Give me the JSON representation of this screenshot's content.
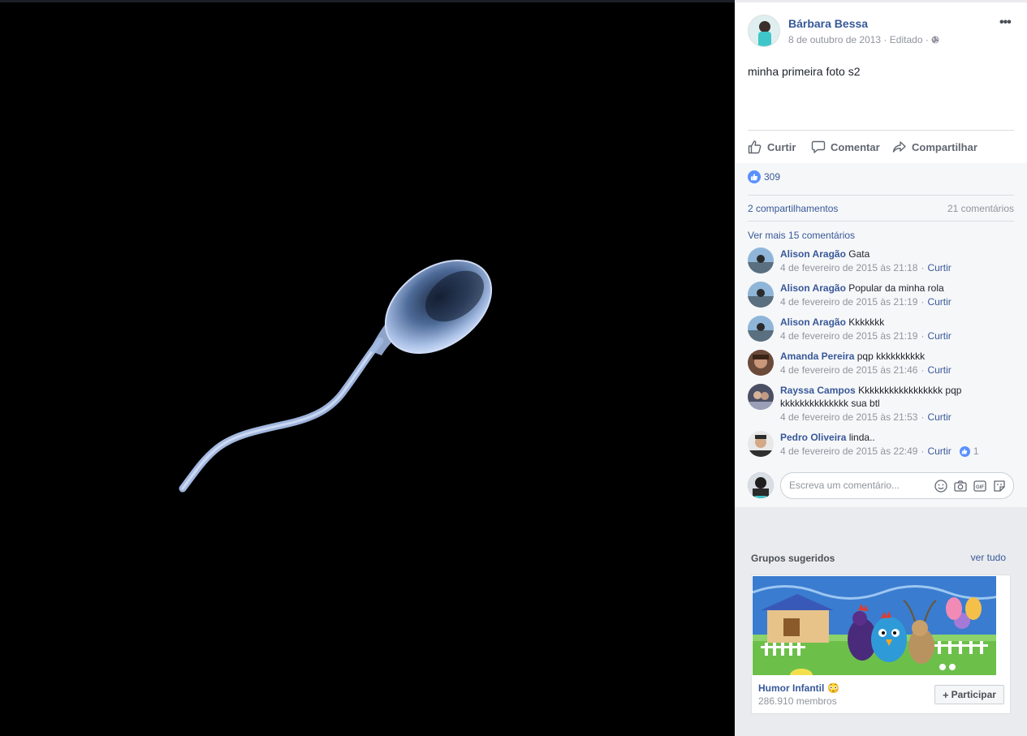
{
  "post": {
    "author": "Bárbara Bessa",
    "date": "8 de outubro de 2013",
    "edited": "Editado",
    "separator": "·",
    "more_icon": "more-options-icon",
    "privacy_icon": "globe-icon",
    "text": "minha primeira foto s2"
  },
  "actions": {
    "like": "Curtir",
    "comment": "Comentar",
    "share": "Compartilhar"
  },
  "stats": {
    "reactions": "309",
    "shares": "2 compartilhamentos",
    "comments": "21 comentários"
  },
  "comments_section": {
    "view_more": "Ver mais 15 comentários",
    "reply_label": "Curtir",
    "items": [
      {
        "name": "Alison Aragão",
        "text": "Gata",
        "time": "4 de fevereiro de 2015 às 21:18"
      },
      {
        "name": "Alison Aragão",
        "text": "Popular da minha rola",
        "time": "4 de fevereiro de 2015 às 21:19"
      },
      {
        "name": "Alison Aragão",
        "text": "Kkkkkkk",
        "time": "4 de fevereiro de 2015 às 21:19"
      },
      {
        "name": "Amanda Pereira",
        "text": "pqp kkkkkkkkkk",
        "time": "4 de fevereiro de 2015 às 21:46"
      },
      {
        "name": "Rayssa Campos",
        "text": "Kkkkkkkkkkkkkkkkk pqp kkkkkkkkkkkkkk sua btl",
        "time": "4 de fevereiro de 2015 às 21:53"
      },
      {
        "name": "Pedro Oliveira",
        "text": "linda..",
        "time": "4 de fevereiro de 2015 às 22:49",
        "likes": "1"
      }
    ]
  },
  "composer": {
    "placeholder": "Escreva um comentário...",
    "icons": [
      "emoji-icon",
      "camera-icon",
      "gif-icon",
      "sticker-icon"
    ]
  },
  "suggested": {
    "title": "Grupos sugeridos",
    "see_all": "ver tudo",
    "group": {
      "name": "Humor Infantil",
      "emoji": "😳",
      "members": "286.910 membros",
      "join_label": "Participar"
    }
  },
  "colors": {
    "link": "#385898",
    "panel_bg": "#e9ebee",
    "like_blue": "#5890ff",
    "photo_bg": "#000000"
  }
}
